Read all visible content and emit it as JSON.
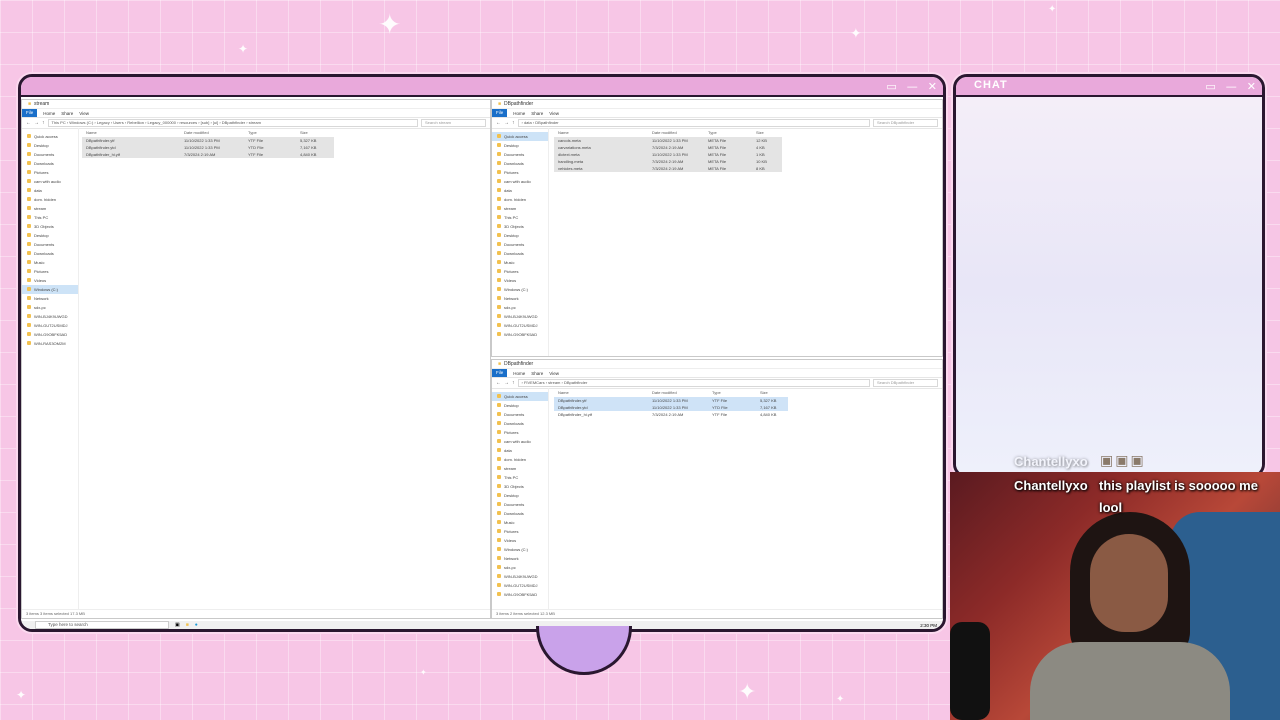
{
  "chat": {
    "title": "CHAT",
    "user_ghost": "Chantellyxo",
    "user": "Chantellyxo",
    "message_line1": "this playlist is sooooo me",
    "message_line2": "lool"
  },
  "taskbar": {
    "search_placeholder": "Type here to search",
    "time": "2:30 PM"
  },
  "win_left": {
    "title": "stream",
    "tabs": [
      "File",
      "Home",
      "Share",
      "View"
    ],
    "path": "This PC › Windows (C:) › Legacy › Users › Rebellion › Legacy_000000 › resources › [sub] › [ui] › DBpathfinder › stream",
    "search": "Search stream",
    "nav": [
      "Quick access",
      "Desktop",
      "Documents",
      "Downloads",
      "Pictures",
      "cam with audio",
      "data",
      "dom. hidden",
      "stream",
      "This PC",
      "3D Objects",
      "Desktop",
      "Documents",
      "Downloads",
      "Music",
      "Pictures",
      "Videos",
      "Windows (C:)",
      "Network",
      "sdx-pc",
      "WIN-BJ4K9UWGD",
      "WIN-GUT2USMDJ",
      "WIN-G9OBFK5AD",
      "WIN-RAS3OM2M"
    ],
    "headers": [
      "Name",
      "Date modified",
      "Type",
      "Size"
    ],
    "rows": [
      [
        "DBpathfinder.ytf",
        "11/10/2022 1:33 PM",
        "YTF File",
        "5,327 KB"
      ],
      [
        "DBpathfinder.ytd",
        "11/10/2022 1:33 PM",
        "YTD File",
        "7,167 KB"
      ],
      [
        "DBpathfinder_hi.ytf",
        "7/3/2024 2:19 AM",
        "YTF File",
        "4,840 KB"
      ]
    ],
    "status": "3 items   3 items selected  17.3 MB"
  },
  "win_right_top": {
    "title": "DBpathfinder",
    "tabs": [
      "File",
      "Home",
      "Share",
      "View"
    ],
    "path": "› data › DBpathfinder",
    "search": "Search DBpathfinder",
    "nav": [
      "Quick access",
      "Desktop",
      "Documents",
      "Downloads",
      "Pictures",
      "cam with audio",
      "data",
      "dom. hidden",
      "stream",
      "This PC",
      "3D Objects",
      "Desktop",
      "Documents",
      "Downloads",
      "Music",
      "Pictures",
      "Videos",
      "Windows (C:)",
      "Network",
      "sdx-pc",
      "WIN-BJ4K9UWGD",
      "WIN-GUT2USMDJ",
      "WIN-G9OBFK5AD"
    ],
    "headers": [
      "Name",
      "Date modified",
      "Type",
      "Size"
    ],
    "rows": [
      [
        "carcols.meta",
        "11/10/2022 1:33 PM",
        "META File",
        "12 KB"
      ],
      [
        "carvariations.meta",
        "7/3/2024 2:19 AM",
        "META File",
        "4 KB"
      ],
      [
        "dlctext.meta",
        "11/10/2022 1:33 PM",
        "META File",
        "1 KB"
      ],
      [
        "handling.meta",
        "7/3/2024 2:19 AM",
        "META File",
        "10 KB"
      ],
      [
        "vehicles.meta",
        "7/3/2024 2:19 AM",
        "META File",
        "8 KB"
      ]
    ]
  },
  "win_right_bottom": {
    "title": "DBpathfinder",
    "tabs": [
      "File",
      "Home",
      "Share",
      "View"
    ],
    "path": "› FIVEMCars › stream › DBpathfinder",
    "search": "Search DBpathfinder",
    "nav": [
      "Quick access",
      "Desktop",
      "Documents",
      "Downloads",
      "Pictures",
      "cam with audio",
      "data",
      "dom. hidden",
      "stream",
      "This PC",
      "3D Objects",
      "Desktop",
      "Documents",
      "Downloads",
      "Music",
      "Pictures",
      "Videos",
      "Windows (C:)",
      "Network",
      "sdx-pc",
      "WIN-BJ4K9UWGD",
      "WIN-GUT2USMDJ",
      "WIN-G9OBFK5AD"
    ],
    "headers": [
      "Name",
      "Date modified",
      "Type",
      "Size"
    ],
    "rows": [
      [
        "DBpathfinder.ytf",
        "11/10/2022 1:33 PM",
        "YTF File",
        "5,327 KB"
      ],
      [
        "DBpathfinder.ytd",
        "11/10/2022 1:33 PM",
        "YTD File",
        "7,167 KB"
      ],
      [
        "DBpathfinder_hi.ytf",
        "7/3/2024 2:19 AM",
        "YTF File",
        "4,840 KB"
      ]
    ],
    "status": "3 items   2 items selected  12.3 MB"
  },
  "colors": {
    "background": "#f7c6e6",
    "frame_bar": "#e9a9db",
    "frame_border": "#2a1730",
    "accent": "#1a6fc9"
  }
}
